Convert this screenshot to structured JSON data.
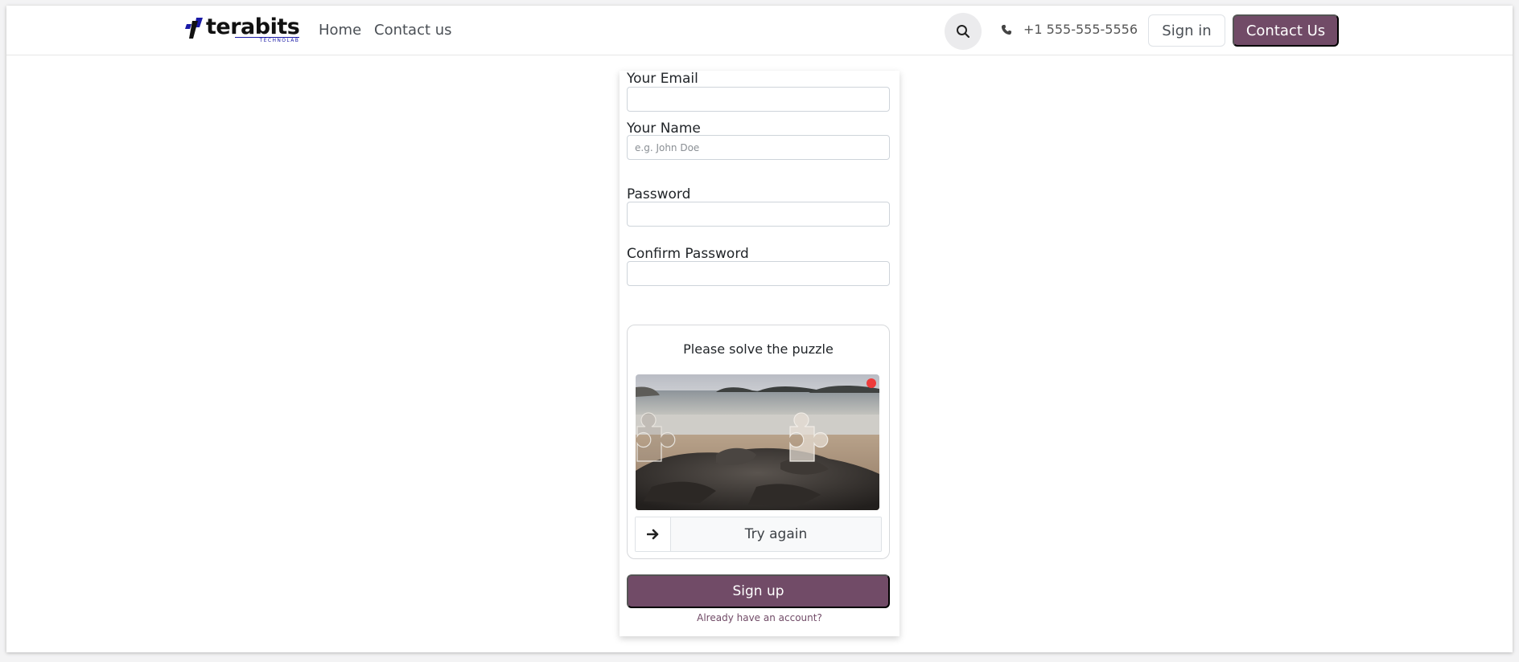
{
  "navbar": {
    "logo_name": "terabits",
    "logo_sub": "TECHNOLAB",
    "links": [
      "Home",
      "Contact us"
    ],
    "phone": "+1 555-555-5556",
    "signin_label": "Sign in",
    "contact_label": "Contact Us",
    "icons": {
      "search": "search-icon",
      "phone": "phone-icon"
    },
    "accent_color": "#714b67"
  },
  "form": {
    "email_label": "Your Email",
    "email_value": "",
    "name_label": "Your Name",
    "name_placeholder": "e.g. John Doe",
    "password_label": "Password",
    "confirm_label": "Confirm Password",
    "puzzle_title": "Please solve the puzzle",
    "try_again": "Try again",
    "signup_label": "Sign up",
    "already_label": "Already have an account?"
  }
}
